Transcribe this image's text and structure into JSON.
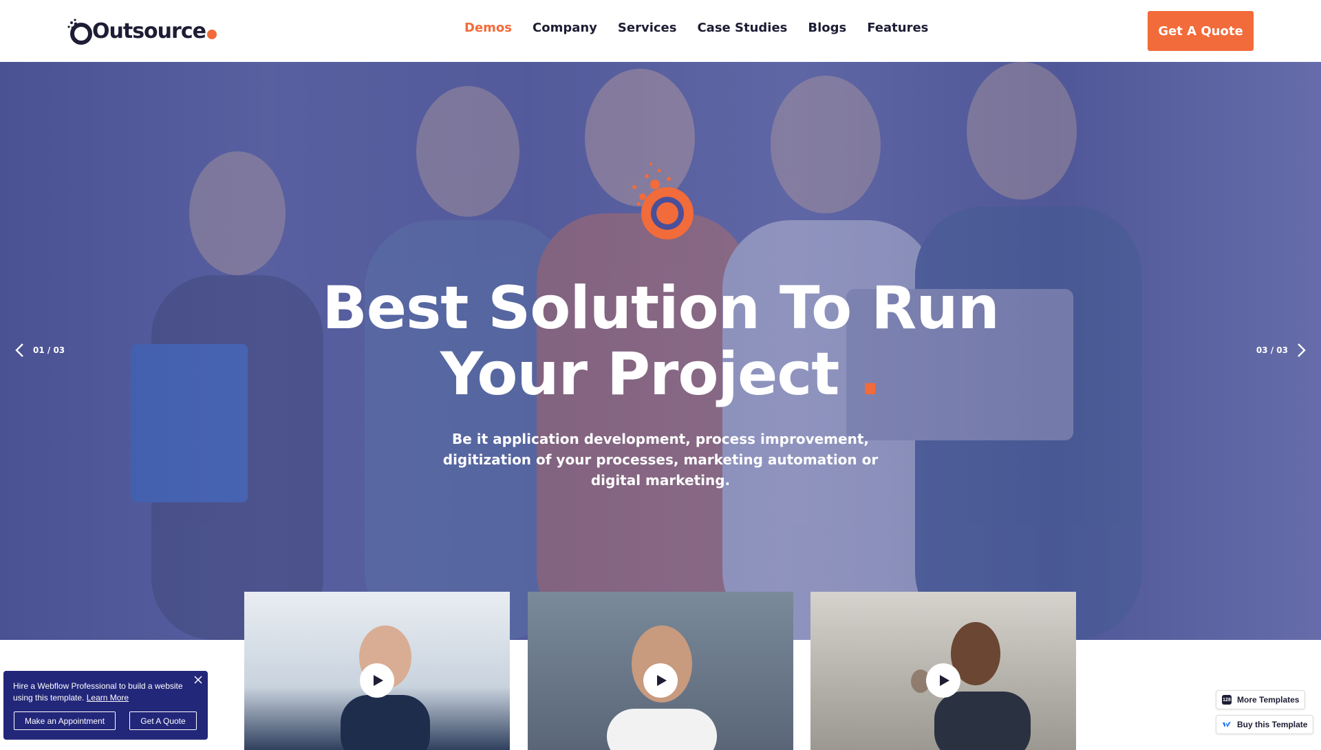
{
  "brand": {
    "name": "Outsource",
    "accent_color": "#f26b3a",
    "dark_color": "#1d1d35",
    "overlay_color": "#3c4496"
  },
  "nav": {
    "items": [
      {
        "label": "Demos",
        "active": true
      },
      {
        "label": "Company",
        "active": false
      },
      {
        "label": "Services",
        "active": false
      },
      {
        "label": "Case Studies",
        "active": false
      },
      {
        "label": "Blogs",
        "active": false
      },
      {
        "label": "Features",
        "active": false
      }
    ],
    "cta_label": "Get A Quote"
  },
  "hero": {
    "title": "Best Solution To Run Your Project",
    "title_accent": ".",
    "subtitle": "Be it application development, process improvement, digitization of your processes, marketing automation or digital marketing.",
    "prev_count": "01 / 03",
    "next_count": "03 / 03"
  },
  "cards": [
    {
      "icon": "play-icon"
    },
    {
      "icon": "play-icon"
    },
    {
      "icon": "play-icon"
    }
  ],
  "popup": {
    "text": "Hire a Webflow Professional to build a website using this template.",
    "link": "Learn More",
    "button_1": "Make an Appointment",
    "button_2": "Get A Quote"
  },
  "template_badges": {
    "more_templates": "More Templates",
    "more_templates_icon_text": "128",
    "buy_template": "Buy this Template"
  }
}
